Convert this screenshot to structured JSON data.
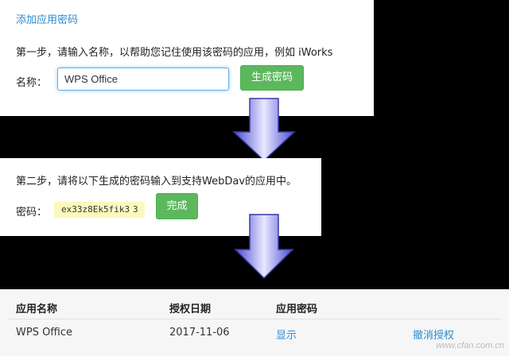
{
  "step1": {
    "title": "添加应用密码",
    "instruction": "第一步，请输入名称，以帮助您记住使用该密码的应用，例如 iWorks",
    "name_label": "名称：",
    "name_value": "WPS Office",
    "generate_button": "生成密码"
  },
  "step2": {
    "instruction": "第二步，请将以下生成的密码输入到支持WebDav的应用中。",
    "password_label": "密码：",
    "password_value": "ex33z8Ek5fik3",
    "password_tail": "3",
    "done_button": "完成"
  },
  "table": {
    "headers": [
      "应用名称",
      "授权日期",
      "应用密码"
    ],
    "rows": [
      {
        "name": "WPS Office",
        "date": "2017-11-06",
        "show": "显示",
        "revoke": "撤消授权"
      }
    ]
  },
  "watermark": "www.cfan.com.cn",
  "colors": {
    "link": "#2a8bd0",
    "button": "#5cb85c",
    "arrow": "#5a5ad8",
    "highlight": "#fcf8bd"
  },
  "icons": [
    "down-arrow-icon",
    "down-arrow-icon"
  ]
}
